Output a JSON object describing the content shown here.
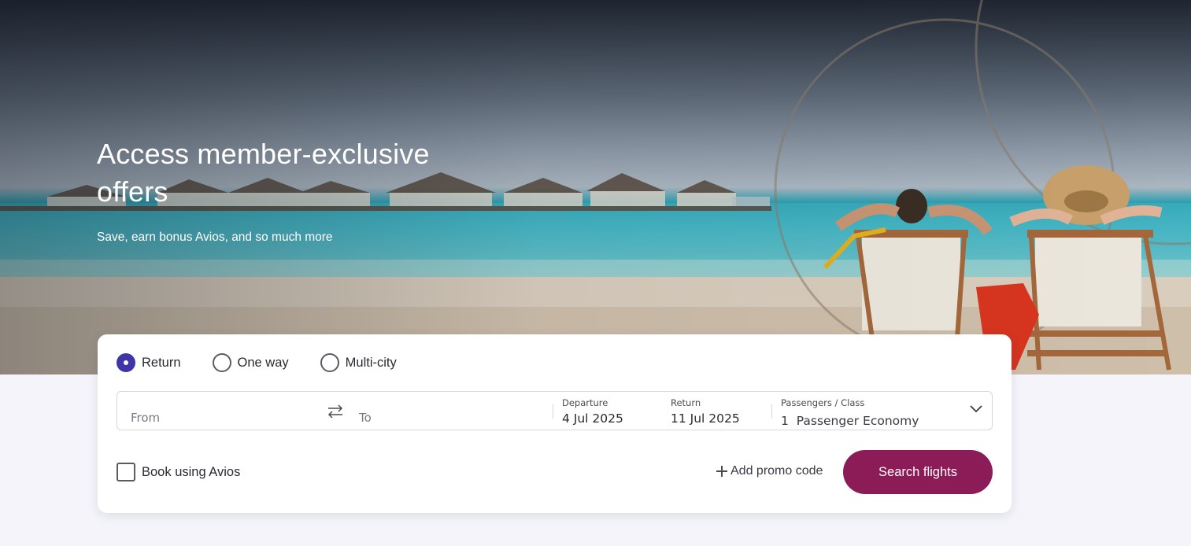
{
  "hero": {
    "title": "Access member-exclusive offers",
    "subtitle": "Save, earn bonus Avios, and so much more"
  },
  "search": {
    "trip_types": [
      {
        "label": "Return",
        "selected": true
      },
      {
        "label": "One way",
        "selected": false
      },
      {
        "label": "Multi-city",
        "selected": false
      }
    ],
    "from_placeholder": "From",
    "to_placeholder": "To",
    "departure": {
      "label": "Departure",
      "value": "4 Jul 2025"
    },
    "return": {
      "label": "Return",
      "value": "11 Jul 2025"
    },
    "passengers": {
      "label": "Passengers / Class",
      "value": "1  Passenger Economy"
    },
    "book_avios_label": "Book using Avios",
    "book_avios_checked": false,
    "promo_label": "Add promo code",
    "submit_label": "Search flights"
  },
  "colors": {
    "accent": "#8b1c57",
    "radio_selected": "#3d35a8",
    "page_background": "#f4f4fa"
  },
  "icons": [
    "swap-icon",
    "chevron-down-icon",
    "plus-icon"
  ]
}
